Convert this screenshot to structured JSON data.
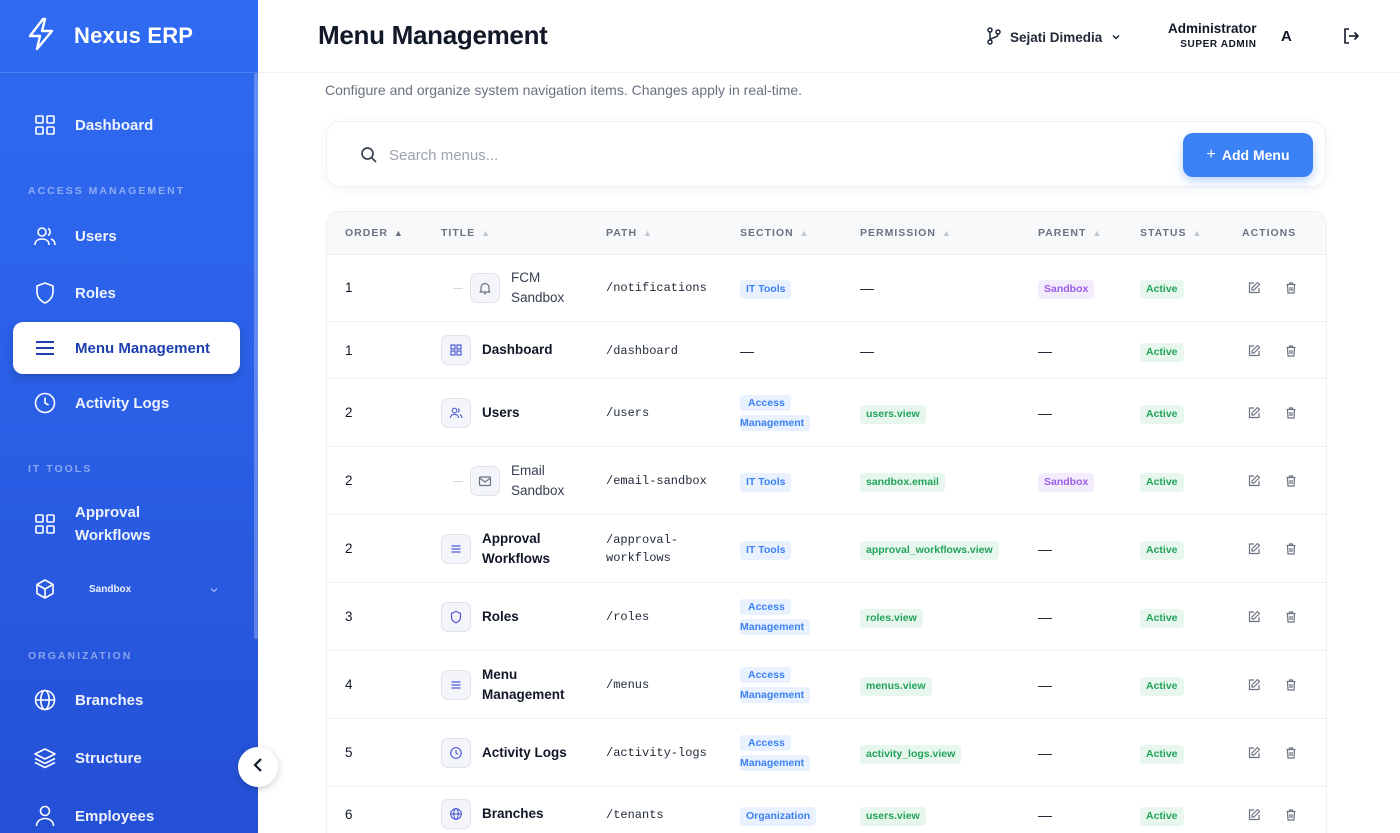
{
  "brand": {
    "name": "Nexus ERP"
  },
  "sidebar": {
    "sections": [
      "ACCESS MANAGEMENT",
      "IT TOOLS",
      "ORGANIZATION"
    ],
    "items": [
      {
        "label": "Dashboard",
        "icon": "grid-icon"
      },
      {
        "label": "Users",
        "icon": "users-icon"
      },
      {
        "label": "Roles",
        "icon": "shield-icon"
      },
      {
        "label": "Menu Management",
        "icon": "menu-icon",
        "active": true
      },
      {
        "label": "Activity Logs",
        "icon": "clock-icon"
      },
      {
        "label": "Approval Workflows",
        "icon": "grid-icon"
      },
      {
        "label": "Sandbox",
        "icon": "cube-icon"
      },
      {
        "label": "Branches",
        "icon": "globe-icon"
      },
      {
        "label": "Structure",
        "icon": "layers-icon"
      },
      {
        "label": "Employees",
        "icon": "user-icon"
      }
    ]
  },
  "header": {
    "title": "Menu Management",
    "tenant": "Sejati Dimedia",
    "user_name": "Administrator",
    "user_role": "SUPER ADMIN",
    "avatar": "A"
  },
  "main": {
    "subtitle": "Configure and organize system navigation items. Changes apply in real-time.",
    "search_placeholder": "Search menus...",
    "add_button": "Add Menu"
  },
  "table": {
    "columns": [
      "ORDER",
      "TITLE",
      "PATH",
      "SECTION",
      "PERMISSION",
      "PARENT",
      "STATUS",
      "ACTIONS"
    ],
    "rows": [
      {
        "order": "1",
        "title_l1": "FCM",
        "title_l2": "Sandbox",
        "path": "/notifications",
        "section": "IT Tools",
        "permission": "—",
        "parent": "Sandbox",
        "status": "Active",
        "icon": "bell-icon"
      },
      {
        "order": "1",
        "title": "Dashboard",
        "path": "/dashboard",
        "section": "—",
        "permission": "—",
        "parent": "—",
        "status": "Active",
        "icon": "grid-icon"
      },
      {
        "order": "2",
        "title": "Users",
        "path": "/users",
        "section_l1": "Access",
        "section_l2": "Management",
        "permission": "users.view",
        "parent": "—",
        "status": "Active",
        "icon": "users-icon"
      },
      {
        "order": "2",
        "title_l1": "Email",
        "title_l2": "Sandbox",
        "path": "/email-sandbox",
        "section": "IT Tools",
        "permission": "sandbox.email",
        "parent": "Sandbox",
        "status": "Active",
        "icon": "mail-icon"
      },
      {
        "order": "2",
        "title_l1": "Approval",
        "title_l2": "Workflows",
        "path_l1": "/approval-",
        "path_l2": "workflows",
        "section": "IT Tools",
        "permission": "approval_workflows.view",
        "parent": "—",
        "status": "Active",
        "icon": "menu-icon"
      },
      {
        "order": "3",
        "title": "Roles",
        "path": "/roles",
        "section_l1": "Access",
        "section_l2": "Management",
        "permission": "roles.view",
        "parent": "—",
        "status": "Active",
        "icon": "shield-icon"
      },
      {
        "order": "4",
        "title_l1": "Menu",
        "title_l2": "Management",
        "path": "/menus",
        "section_l1": "Access",
        "section_l2": "Management",
        "permission": "menus.view",
        "parent": "—",
        "status": "Active",
        "icon": "menu-icon"
      },
      {
        "order": "5",
        "title": "Activity Logs",
        "path": "/activity-logs",
        "section_l1": "Access",
        "section_l2": "Management",
        "permission": "activity_logs.view",
        "parent": "—",
        "status": "Active",
        "icon": "clock-icon"
      },
      {
        "order": "6",
        "title": "Branches",
        "path": "/tenants",
        "section": "Organization",
        "permission": "users.view",
        "parent": "—",
        "status": "Active",
        "icon": "globe-icon"
      }
    ]
  }
}
